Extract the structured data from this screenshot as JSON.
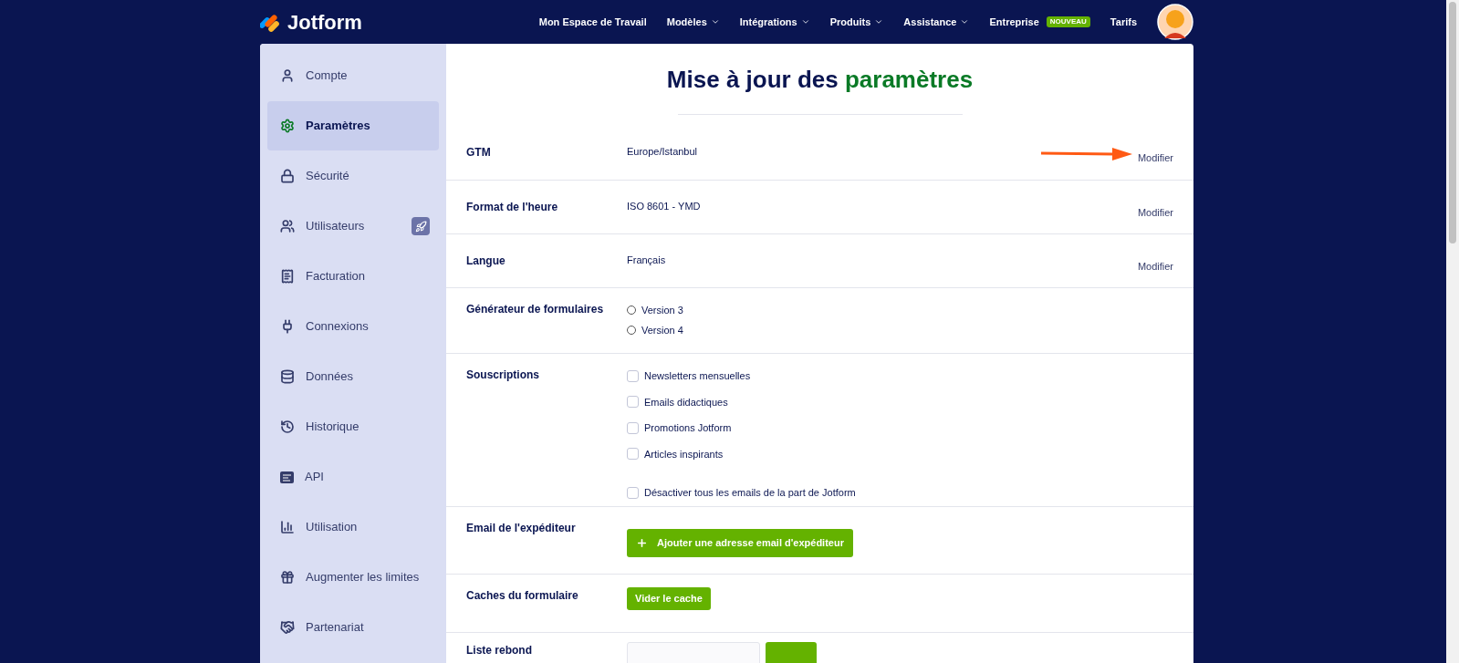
{
  "header": {
    "logo": "Jotform",
    "nav": [
      {
        "label": "Mon Espace de Travail",
        "dropdown": false
      },
      {
        "label": "Modèles",
        "dropdown": true
      },
      {
        "label": "Intégrations",
        "dropdown": true
      },
      {
        "label": "Produits",
        "dropdown": true
      },
      {
        "label": "Assistance",
        "dropdown": true
      },
      {
        "label": "Entreprise",
        "dropdown": false,
        "badge": "NOUVEAU"
      },
      {
        "label": "Tarifs",
        "dropdown": false
      }
    ]
  },
  "sidebar": {
    "items": [
      {
        "label": "Compte",
        "selected": false,
        "upgrade": false
      },
      {
        "label": "Paramètres",
        "selected": true,
        "upgrade": false
      },
      {
        "label": "Sécurité",
        "selected": false,
        "upgrade": false
      },
      {
        "label": "Utilisateurs",
        "selected": false,
        "upgrade": true
      },
      {
        "label": "Facturation",
        "selected": false,
        "upgrade": false
      },
      {
        "label": "Connexions",
        "selected": false,
        "upgrade": false
      },
      {
        "label": "Données",
        "selected": false,
        "upgrade": false
      },
      {
        "label": "Historique",
        "selected": false,
        "upgrade": false
      },
      {
        "label": "API",
        "selected": false,
        "upgrade": false
      },
      {
        "label": "Utilisation",
        "selected": false,
        "upgrade": false
      },
      {
        "label": "Augmenter les limites",
        "selected": false,
        "upgrade": false
      },
      {
        "label": "Partenariat",
        "selected": false,
        "upgrade": false
      }
    ]
  },
  "page": {
    "title": "Mise à jour des **paramètres**"
  },
  "settings": [
    {
      "kind": "text",
      "label": "GTM",
      "value": "Europe/Istanbul",
      "action": "Modifier",
      "highlighted": true
    },
    {
      "kind": "text",
      "label": "Format de l'heure",
      "value": "ISO 8601 - YMD",
      "action": "Modifier",
      "highlighted": false
    },
    {
      "kind": "text",
      "label": "Langue",
      "value": "Français",
      "action": "Modifier",
      "highlighted": false
    },
    {
      "kind": "radio",
      "label": "Générateur de formulaires",
      "options": [
        {
          "label": "Version 3",
          "selected": false
        },
        {
          "label": "Version 4",
          "selected": false
        }
      ]
    },
    {
      "kind": "checkbox",
      "label": "Souscriptions",
      "options": [
        {
          "label": "Newsletters mensuelles",
          "checked": false
        },
        {
          "label": "Emails didactiques",
          "checked": false
        },
        {
          "label": "Promotions Jotform",
          "checked": false
        },
        {
          "label": "Articles inspirants",
          "checked": false
        }
      ],
      "extra": {
        "label": "Désactiver tous les emails de la part de Jotform",
        "checked": false
      }
    },
    {
      "kind": "button",
      "label": "Email de l'expéditeur",
      "button": "Ajouter une adresse email d'expéditeur",
      "plus": true
    },
    {
      "kind": "button",
      "label": "Caches du formulaire",
      "button": "Vider le cache",
      "plus": false
    },
    {
      "kind": "input",
      "label": "Liste rebond"
    }
  ]
}
